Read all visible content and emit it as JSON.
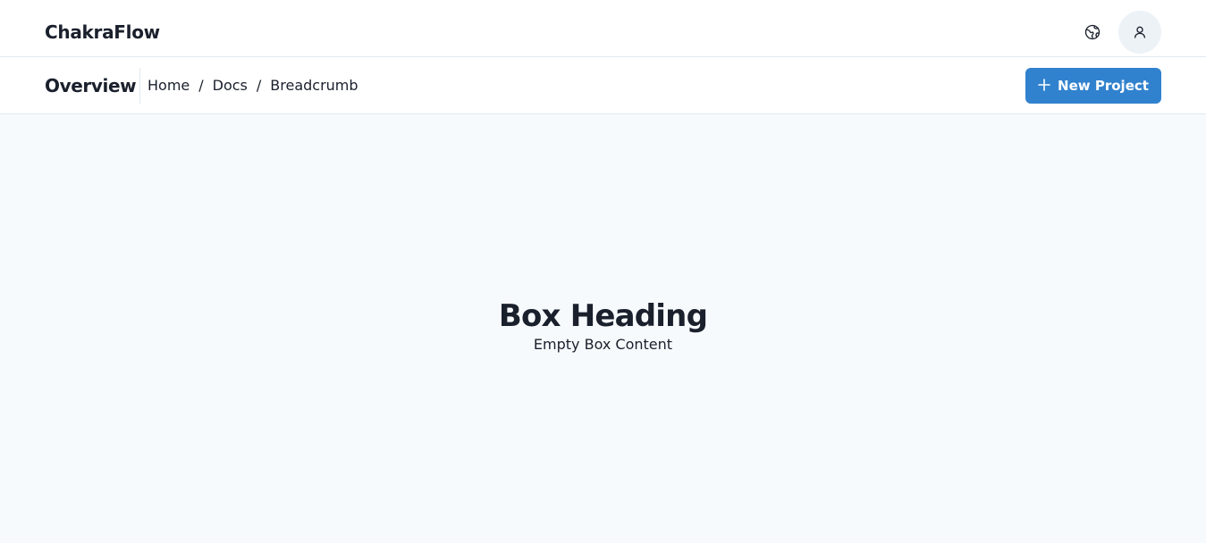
{
  "app": {
    "brand": "ChakraFlow"
  },
  "header": {
    "language_icon": "globe-icon",
    "avatar_icon": "user-icon"
  },
  "subheader": {
    "title": "Overview",
    "breadcrumb": [
      {
        "label": "Home"
      },
      {
        "label": "Docs"
      },
      {
        "label": "Breadcrumb"
      }
    ],
    "separator": "/",
    "new_project": {
      "label": "New Project",
      "icon": "plus-icon"
    }
  },
  "main": {
    "heading": "Box Heading",
    "content": "Empty Box Content"
  },
  "colors": {
    "accent": "#3182CE",
    "text": "#1A202C",
    "background": "#F7FAFC",
    "border": "#E2E8F0",
    "avatar_bg": "#EDF2F7"
  }
}
